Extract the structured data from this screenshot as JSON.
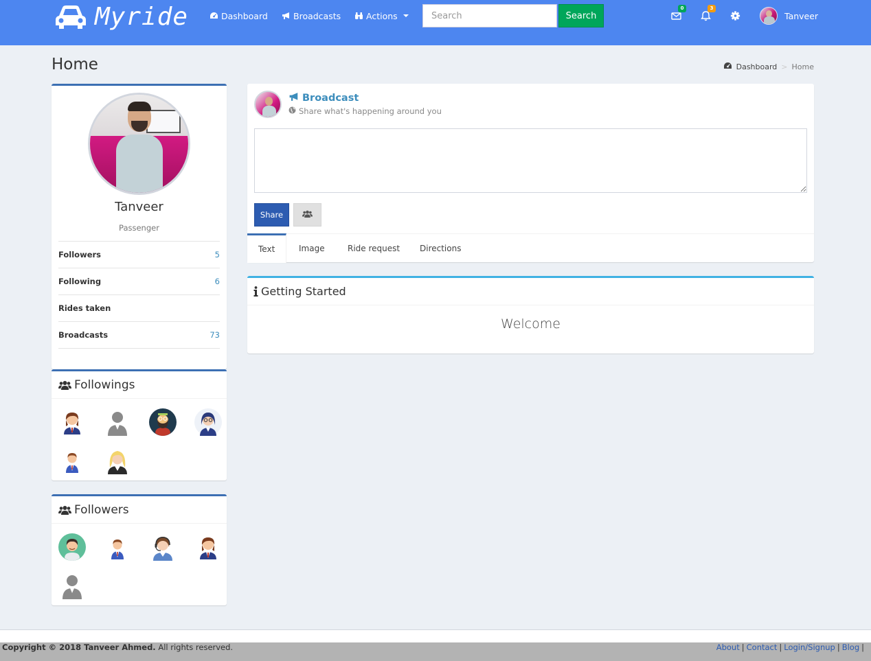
{
  "navbar": {
    "brand": "Myride",
    "links": [
      {
        "label": "Dashboard",
        "icon": "dashboard-icon"
      },
      {
        "label": "Broadcasts",
        "icon": "bullhorn-icon"
      },
      {
        "label": "Actions",
        "icon": "binoculars-icon"
      }
    ],
    "search_placeholder": "Search",
    "search_button": "Search",
    "messages_count": "0",
    "notifications_count": "3",
    "user_name": "Tanveer",
    "colors": {
      "bar": "#4d86f0",
      "search_button": "#00a65a"
    }
  },
  "page": {
    "title": "Home",
    "breadcrumb": {
      "root": "Dashboard",
      "current": "Home"
    }
  },
  "profile": {
    "name": "Tanveer",
    "role": "Passenger",
    "stats": [
      {
        "label": "Followers",
        "value": "5"
      },
      {
        "label": "Following",
        "value": "6"
      },
      {
        "label": "Rides taken",
        "value": ""
      },
      {
        "label": "Broadcasts",
        "value": "73"
      }
    ]
  },
  "followings": {
    "title": "Followings",
    "people": [
      "woman-avatar",
      "default-avatar",
      "bearded-man-avatar",
      "woman-glasses-avatar",
      "businessman-avatar",
      "blonde-woman-avatar"
    ]
  },
  "followers": {
    "title": "Followers",
    "people": [
      "man-green-avatar",
      "businessman-avatar",
      "headset-woman-avatar",
      "woman-avatar",
      "default-avatar"
    ]
  },
  "broadcast": {
    "title": "Broadcast",
    "subtitle": "Share what's happening around you",
    "share_button": "Share",
    "tabs": [
      "Text",
      "Image",
      "Ride request",
      "Directions"
    ]
  },
  "getting_started": {
    "title": "Getting Started",
    "welcome": "Welcome"
  },
  "footer": {
    "copyright_bold": "Copyright © 2018 Tanveer Ahmed.",
    "copyright_rest": " All rights reserved.",
    "links": [
      "About",
      "Contact",
      "Login/Signup",
      "Blog"
    ]
  }
}
